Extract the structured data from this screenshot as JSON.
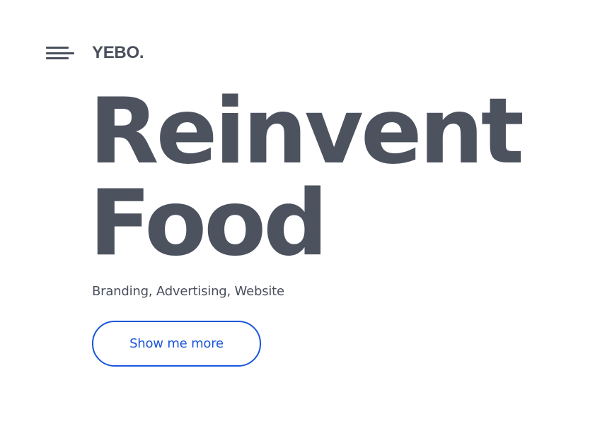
{
  "header": {
    "logo_text": "YEBO.",
    "menu_icon": "hamburger-menu-icon"
  },
  "hero": {
    "title_line1": "Reinvent",
    "title_line2": "Food",
    "subtitle": "Branding, Advertising, Website",
    "cta_label": "Show me more"
  },
  "colors": {
    "text": "#4a4f5c",
    "accent": "#1a56db",
    "background": "#ffffff"
  }
}
